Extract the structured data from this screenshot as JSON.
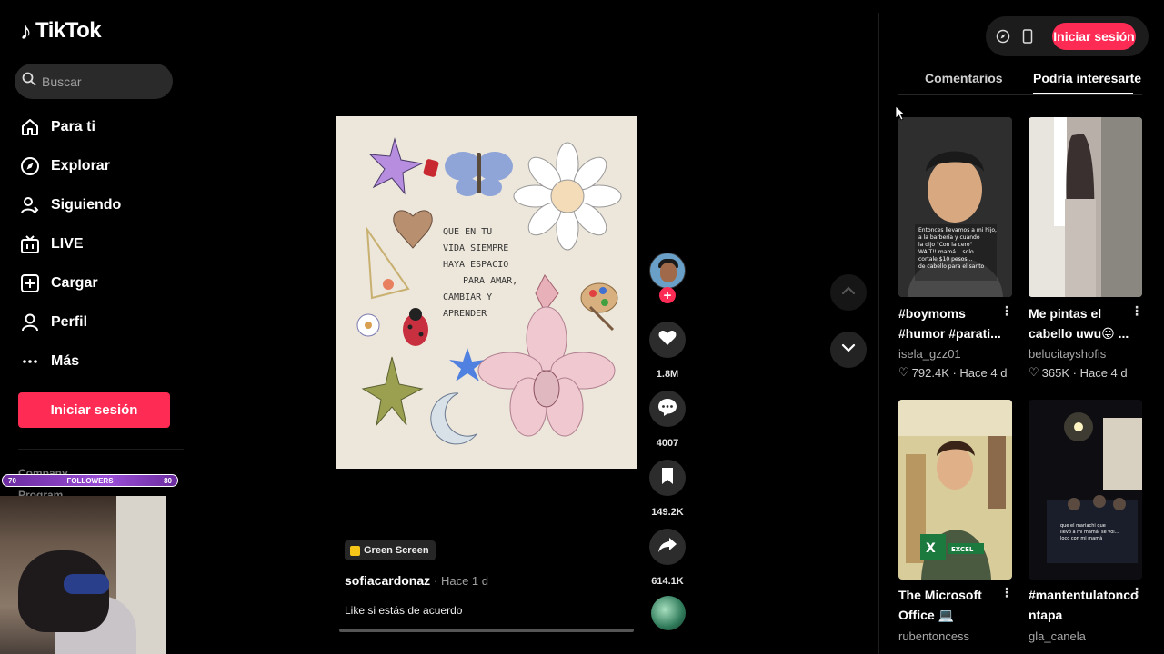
{
  "app": {
    "logo_text": "TikTok"
  },
  "search": {
    "placeholder": "Buscar"
  },
  "nav": [
    {
      "label": "Para ti",
      "icon": "home-icon"
    },
    {
      "label": "Explorar",
      "icon": "compass-icon"
    },
    {
      "label": "Siguiendo",
      "icon": "user-follow-icon"
    },
    {
      "label": "LIVE",
      "icon": "live-tv-icon"
    },
    {
      "label": "Cargar",
      "icon": "upload-plus-icon"
    },
    {
      "label": "Perfil",
      "icon": "profile-icon"
    },
    {
      "label": "Más",
      "icon": "more-dots-icon"
    }
  ],
  "sidebar": {
    "login_label": "Iniciar sesión",
    "footer_company": "Company",
    "footer_program": "Program"
  },
  "overlay": {
    "followers_min": "70",
    "followers_label": "FOLLOWERS",
    "followers_max": "80",
    "followers_progress": 0.5
  },
  "video": {
    "badge": "Green Screen",
    "author": "sofiacardonaz",
    "time": "· Hace 1 d",
    "description": "Like si estás de acuerdo",
    "likes": "1.8M",
    "comments": "4007",
    "saves": "149.2K",
    "shares": "614.1K",
    "plus": "+"
  },
  "topbar": {
    "login_label": "Iniciar sesión"
  },
  "tabs": {
    "comments": "Comentarios",
    "interest": "Podría interesarte"
  },
  "cards": [
    {
      "title_line1": "#boymoms",
      "title_line2": "#humor #parati...",
      "author": "isela_gzz01",
      "stats": "792.4K · Hace 4 d"
    },
    {
      "title_line1": "Me pintas el",
      "title_line2": "cabello uwu😛 ...",
      "author": "belucitayshofis",
      "stats": "365K · Hace 4 d"
    },
    {
      "title_line1": "The Microsoft",
      "title_line2": "Office 💻",
      "author": "rubentoncess",
      "stats": ""
    },
    {
      "title_line1": "#mantentulatonco",
      "title_line2": "ntapa",
      "author": "gla_canela",
      "stats": ""
    }
  ],
  "colors": {
    "accent": "#fe2c55",
    "bg": "#000000",
    "followers_bar": "#9a4ed6"
  }
}
